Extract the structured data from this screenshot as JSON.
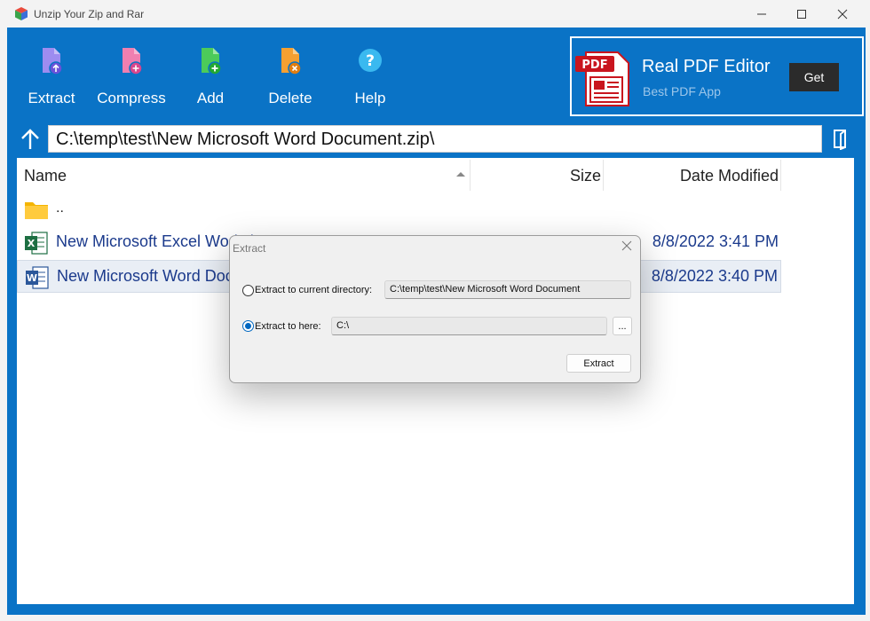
{
  "window": {
    "title": "Unzip Your Zip and Rar",
    "controls": {
      "minimize_icon": "minimize-icon",
      "maximize_icon": "maximize-icon",
      "close_icon": "close-icon"
    }
  },
  "colors": {
    "accent": "#0a73c6",
    "link_text": "#1b3a8c",
    "ad_button": "#2b2b2b",
    "radio_checked": "#0067c0"
  },
  "toolbar": {
    "extract_label": "Extract",
    "compress_label": "Compress",
    "add_label": "Add",
    "delete_label": "Delete",
    "help_label": "Help"
  },
  "ad": {
    "icon_text": "PDF",
    "title": "Real PDF Editor",
    "subtitle": "Best PDF App",
    "button_label": "Get"
  },
  "path_bar": {
    "path": "C:\\temp\\test\\New Microsoft Word Document.zip\\"
  },
  "file_list": {
    "columns": {
      "name": "Name",
      "size": "Size",
      "date": "Date Modified"
    },
    "rows": [
      {
        "name": "..",
        "size": "",
        "date": "",
        "icon": "folder-icon"
      },
      {
        "name": "New Microsoft Excel Worksheet",
        "size": "",
        "date": "8/8/2022 3:41 PM",
        "icon": "excel-file-icon"
      },
      {
        "name": "New Microsoft Word Document",
        "size": "",
        "date": "8/8/2022 3:40 PM",
        "icon": "word-file-icon",
        "selected": true
      }
    ]
  },
  "dialog": {
    "title": "Extract",
    "option_current_label": "Extract to current directory:",
    "option_current_value": "C:\\temp\\test\\New Microsoft Word Document",
    "option_here_label": "Extract to here:",
    "option_here_value": "C:\\",
    "browse_label": "...",
    "extract_button": "Extract",
    "selected_option": "here"
  }
}
